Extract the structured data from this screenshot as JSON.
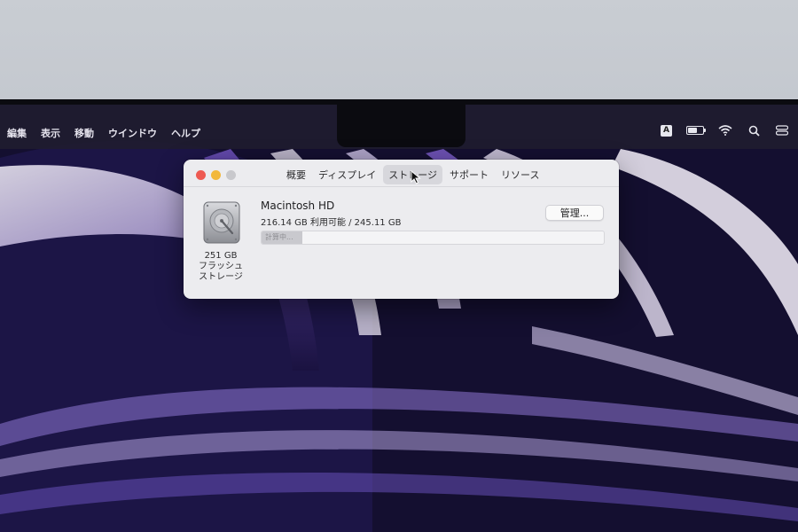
{
  "menubar": {
    "items": [
      {
        "label": "編集"
      },
      {
        "label": "表示"
      },
      {
        "label": "移動"
      },
      {
        "label": "ウインドウ"
      },
      {
        "label": "ヘルプ"
      }
    ],
    "input_source": "A",
    "battery_level": 0.65
  },
  "window": {
    "tabs": [
      {
        "label": "概要",
        "active": false
      },
      {
        "label": "ディスプレイ",
        "active": false
      },
      {
        "label": "ストレージ",
        "active": true
      },
      {
        "label": "サポート",
        "active": false
      },
      {
        "label": "リソース",
        "active": false
      }
    ],
    "storage": {
      "disk_size": "251 GB",
      "disk_type_line1": "フラッシュ",
      "disk_type_line2": "ストレージ",
      "volume_name": "Macintosh HD",
      "volume_detail": "216.14 GB 利用可能 / 245.11 GB",
      "manage_label": "管理...",
      "progress_text": "計算中...",
      "progress_fraction": 0.12
    }
  },
  "colors": {
    "close": "#ee5a52",
    "minimize": "#f2b83c",
    "zoom_inactive": "#c8c8cc"
  }
}
